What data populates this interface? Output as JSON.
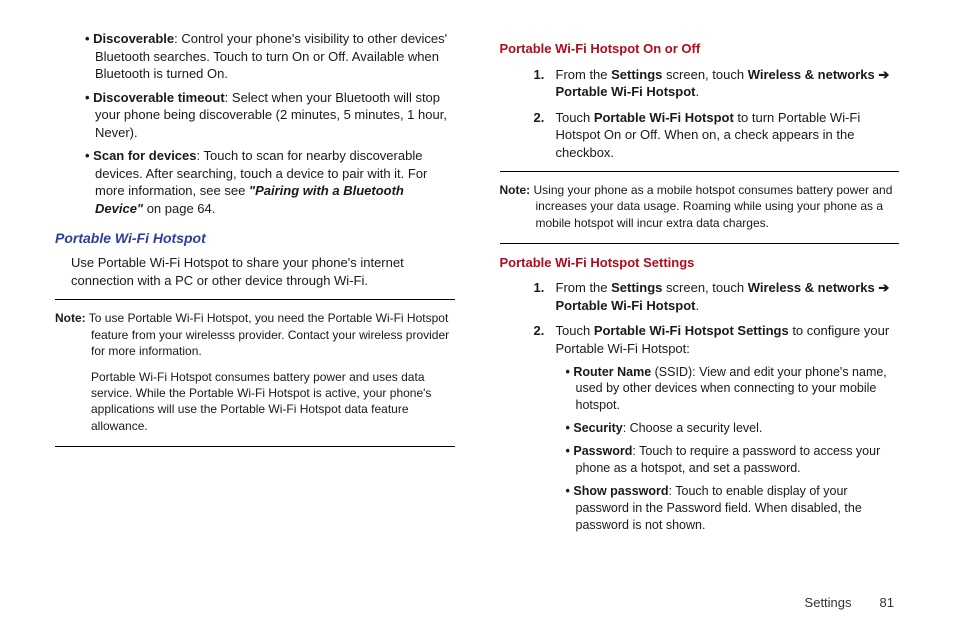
{
  "left": {
    "bullets": [
      {
        "term": "Discoverable",
        "desc": ": Control your phone's visibility to other devices' Bluetooth searches. Touch to turn On or Off. Available when Bluetooth is turned On."
      },
      {
        "term": "Discoverable timeout",
        "desc": ": Select when your Bluetooth will stop your phone being discoverable (2 minutes, 5 minutes, 1 hour, Never)."
      },
      {
        "term": "Scan for devices",
        "desc_pre": ": Touch to scan for nearby discoverable devices. After searching, touch a device to pair with it. For more information, see see ",
        "ref": "\"Pairing with a Bluetooth Device\"",
        "desc_post": " on page 64."
      }
    ],
    "section_heading": "Portable Wi-Fi Hotspot",
    "section_body": "Use Portable Wi-Fi Hotspot to share your phone's internet connection with a PC or other device through Wi-Fi.",
    "note_label": "Note:",
    "note_p1": "To use Portable Wi-Fi Hotspot, you need the Portable Wi-Fi Hotspot feature from your wirelesss provider. Contact your wireless provider for more information.",
    "note_p2": "Portable Wi-Fi Hotspot consumes battery power and uses data service. While the Portable Wi-Fi Hotspot is active, your phone's applications will use the Portable Wi-Fi Hotspot data feature allowance."
  },
  "right": {
    "heading_onoff": "Portable Wi-Fi Hotspot On or Off",
    "step1_pre": "From the ",
    "step1_b1": "Settings",
    "step1_mid": " screen, touch ",
    "step1_b2": "Wireless & networks",
    "step1_arrow": "  ➔ ",
    "step1_b3": "Portable Wi-Fi Hotspot",
    "step1_post": ".",
    "step2_pre": "Touch ",
    "step2_b": "Portable Wi-Fi Hotspot",
    "step2_post": " to turn Portable Wi-Fi Hotspot On or Off. When on, a check appears in the checkbox.",
    "note_label": "Note:",
    "note_body": "Using your phone as a mobile hotspot consumes battery power and increases your data usage. Roaming while using your phone as a mobile hotspot will incur extra data charges.",
    "heading_settings": "Portable Wi-Fi Hotspot Settings",
    "s_step1_pre": "From the ",
    "s_step1_b1": "Settings",
    "s_step1_mid": " screen, touch ",
    "s_step1_b2": "Wireless & networks",
    "s_step1_arrow": "  ➔ ",
    "s_step1_b3": "Portable Wi-Fi Hotspot",
    "s_step1_post": ".",
    "s_step2_pre": "Touch ",
    "s_step2_b": "Portable Wi-Fi Hotspot Settings",
    "s_step2_post": " to configure your Portable Wi-Fi Hotspot:",
    "sbullets": [
      {
        "term": "Router Name",
        "paren": " (SSID)",
        "desc": ": View and edit your phone's name, used by other devices when connecting to your mobile hotspot."
      },
      {
        "term": "Security",
        "paren": "",
        "desc": ": Choose a security level."
      },
      {
        "term": "Password",
        "paren": "",
        "desc": ": Touch to require a password to access your phone as a hotspot, and set a password."
      },
      {
        "term": "Show password",
        "paren": "",
        "desc": ": Touch to enable display of your password in the Password field. When disabled, the password is not shown."
      }
    ]
  },
  "footer": {
    "section": "Settings",
    "page": "81"
  }
}
